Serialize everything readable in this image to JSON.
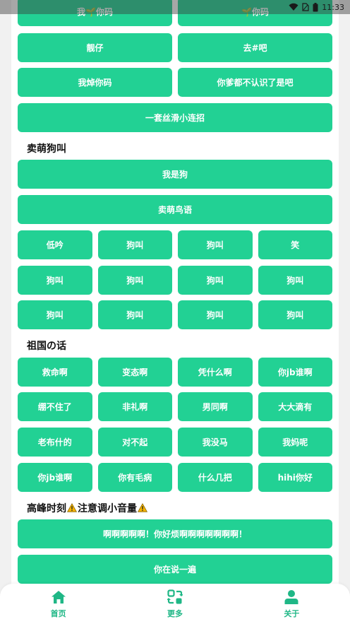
{
  "status_bar": {
    "time": "11:33"
  },
  "colors": {
    "accent": "#22d194",
    "tab_color": "#1fb786"
  },
  "rows_top": [
    [
      "我🌱你码",
      "🌱你码"
    ],
    [
      "靓仔",
      "去#吧"
    ],
    [
      "我焯你码",
      "你爹都不认识了是吧"
    ],
    [
      "一套丝滑小连招"
    ]
  ],
  "section_moe": {
    "title": "卖萌狗叫",
    "rows": [
      [
        "我是狗"
      ],
      [
        "卖萌鸟语"
      ],
      [
        "低吟",
        "狗叫",
        "狗叫",
        "笑"
      ],
      [
        "狗叫",
        "狗叫",
        "狗叫",
        "狗叫"
      ],
      [
        "狗叫",
        "狗叫",
        "狗叫",
        "狗叫"
      ]
    ]
  },
  "section_motherland": {
    "title": "祖国の话",
    "rows": [
      [
        "救命啊",
        "变态啊",
        "凭什么啊",
        "你jb谁啊"
      ],
      [
        "绷不住了",
        "非礼啊",
        "男同啊",
        "大大滴有"
      ],
      [
        "老布什的",
        "对不起",
        "我没马",
        "我妈呢"
      ],
      [
        "你jb谁啊",
        "你有毛病",
        "什么几把",
        "hihi你好"
      ]
    ]
  },
  "section_peak": {
    "title_a": "高峰时刻",
    "title_b": "注意调小音量",
    "rows": [
      [
        "啊啊啊啊啊！你好烦啊啊啊啊啊啊啊！"
      ],
      [
        "你在说一遍"
      ]
    ]
  },
  "tabs": [
    {
      "label": "首页",
      "icon": "home-icon"
    },
    {
      "label": "更多",
      "icon": "refresh-icon"
    },
    {
      "label": "关于",
      "icon": "person-icon"
    }
  ]
}
